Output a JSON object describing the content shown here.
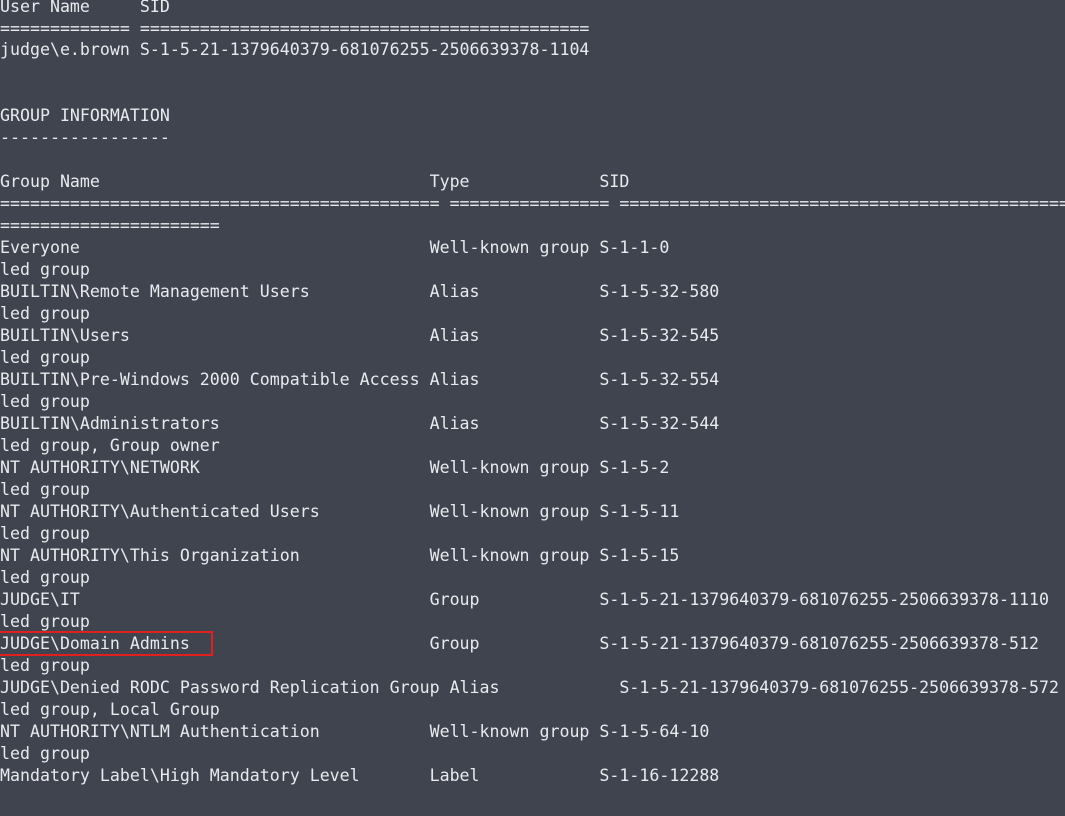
{
  "terminal": {
    "lines": [
      "User Name     SID",
      "============= =============================================",
      "judge\\e.brown S-1-5-21-1379640379-681076255-2506639378-1104",
      "",
      "",
      "GROUP INFORMATION",
      "-----------------",
      "",
      "Group Name                                 Type             SID",
      "============================================ ================ ===============================================",
      "======================",
      "Everyone                                   Well-known group S-1-1-0",
      "led group",
      "BUILTIN\\Remote Management Users            Alias            S-1-5-32-580",
      "led group",
      "BUILTIN\\Users                              Alias            S-1-5-32-545",
      "led group",
      "BUILTIN\\Pre-Windows 2000 Compatible Access Alias            S-1-5-32-554",
      "led group",
      "BUILTIN\\Administrators                     Alias            S-1-5-32-544",
      "led group, Group owner",
      "NT AUTHORITY\\NETWORK                       Well-known group S-1-5-2",
      "led group",
      "NT AUTHORITY\\Authenticated Users           Well-known group S-1-5-11",
      "led group",
      "NT AUTHORITY\\This Organization             Well-known group S-1-5-15",
      "led group",
      "JUDGE\\IT                                   Group            S-1-5-21-1379640379-681076255-2506639378-1110",
      "led group",
      "JUDGE\\Domain Admins                        Group            S-1-5-21-1379640379-681076255-2506639378-512",
      "led group",
      "JUDGE\\Denied RODC Password Replication Group Alias            S-1-5-21-1379640379-681076255-2506639378-572",
      "led group, Local Group",
      "NT AUTHORITY\\NTLM Authentication           Well-known group S-1-5-64-10",
      "led group",
      "Mandatory Label\\High Mandatory Level       Label            S-1-16-12288"
    ]
  },
  "colors": {
    "background": "#3f444f",
    "text": "#e8eaee",
    "highlight_border": "#e0201f"
  }
}
